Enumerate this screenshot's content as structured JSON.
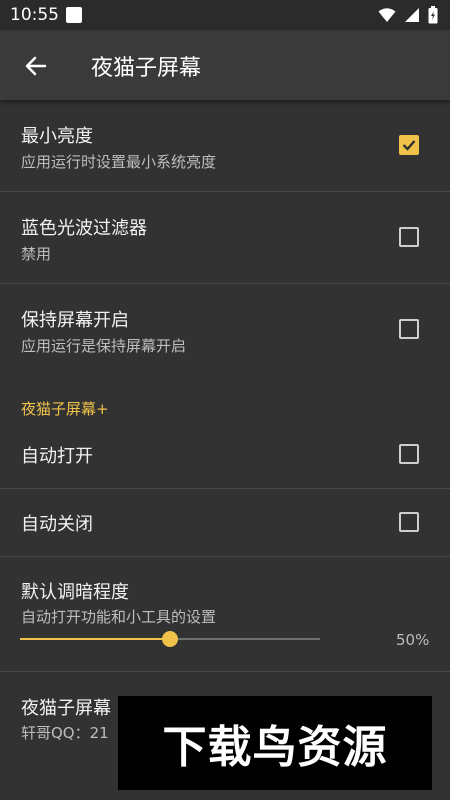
{
  "status": {
    "time": "10:55"
  },
  "appbar": {
    "title": "夜猫子屏幕"
  },
  "settings": [
    {
      "title": "最小亮度",
      "subtitle": "应用运行时设置最小系统亮度",
      "checked": true
    },
    {
      "title": "蓝色光波过滤器",
      "subtitle": "禁用",
      "checked": false
    },
    {
      "title": "保持屏幕开启",
      "subtitle": "应用运行是保持屏幕开启",
      "checked": false
    }
  ],
  "section_plus": {
    "label": "夜猫子屏幕+"
  },
  "plus_settings": [
    {
      "title": "自动打开",
      "checked": false
    },
    {
      "title": "自动关闭",
      "checked": false
    }
  ],
  "dim": {
    "title": "默认调暗程度",
    "subtitle": "自动打开功能和小工具的设置",
    "value": 0.5,
    "value_label": "50%"
  },
  "about": {
    "title": "夜猫子屏幕",
    "subtitle": "轩哥QQ：21"
  },
  "watermark": {
    "text": "下载鸟资源"
  },
  "colors": {
    "accent": "#f0c24a",
    "background": "#323232",
    "appbar": "#3a3a3a"
  }
}
